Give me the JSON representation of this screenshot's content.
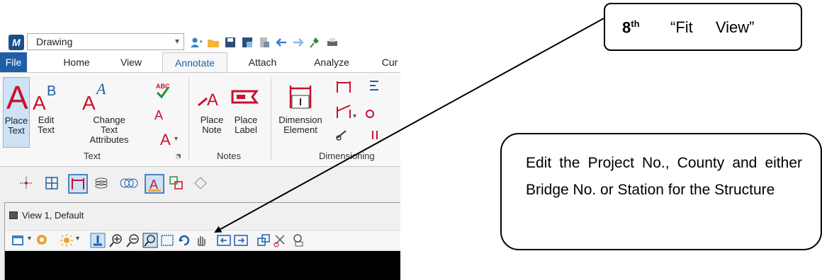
{
  "app": {
    "logo": "M",
    "file_combo": "Drawing",
    "tabs": [
      "File",
      "Home",
      "View",
      "Annotate",
      "Attach",
      "Analyze",
      "Cur"
    ],
    "active_tab": "Annotate",
    "ribbon": {
      "place_text": "Place Text",
      "edit_text": "Edit Text",
      "change_text_attributes": "Change Text Attributes",
      "text_group": "Text",
      "place_note": "Place Note",
      "place_label": "Place Label",
      "notes_group": "Notes",
      "dimension_element": "Dimension Element",
      "dimensioning_group": "Dimensioning"
    },
    "view_window_title": "View 1, Default"
  },
  "callout_fit_view": {
    "ordinal": "8",
    "ordinal_suffix": "th",
    "text": "“Fit View”"
  },
  "callout_edit": {
    "text": "Edit the Project No., County and either Bridge No. or Station for the Structure"
  },
  "colors": {
    "file_tab": "#1e5fa8",
    "active_tab_text": "#1e5fa8",
    "text_icon_red": "#c8102e",
    "canvas": "#000000"
  }
}
